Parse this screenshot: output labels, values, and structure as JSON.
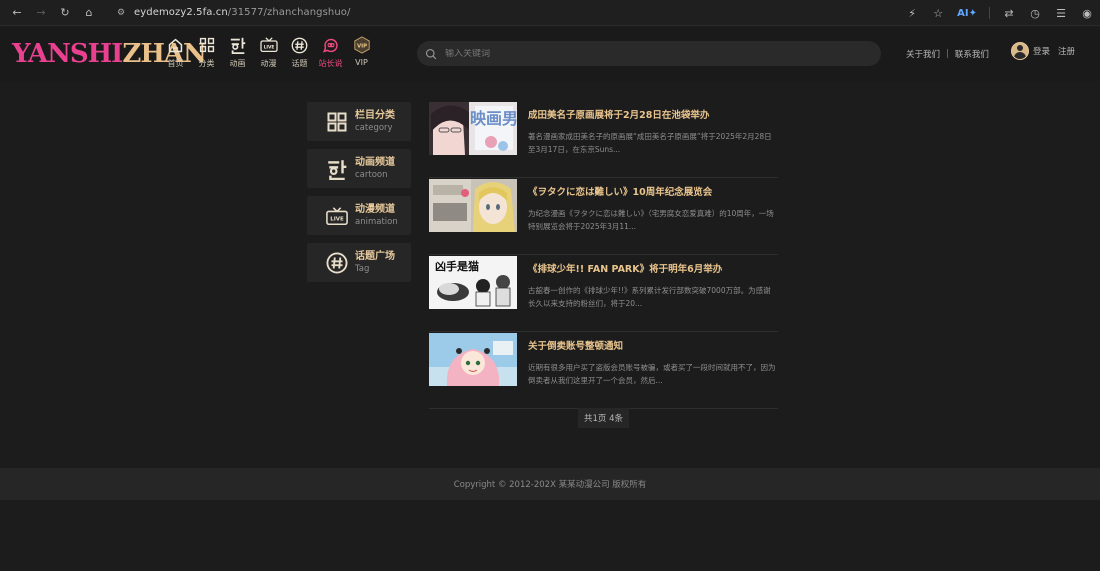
{
  "browser": {
    "url_host": "eydemozy2.5fa.cn",
    "url_path": "/31577/zhanchangshuo/",
    "ai_label": "AI"
  },
  "logo": {
    "part1": "YANSHI",
    "part2": "ZHAN"
  },
  "nav": {
    "items": [
      {
        "label": "首页",
        "icon": "home-icon"
      },
      {
        "label": "分类",
        "icon": "grid-icon"
      },
      {
        "label": "动画",
        "icon": "han-icon"
      },
      {
        "label": "动漫",
        "icon": "live-icon"
      },
      {
        "label": "话题",
        "icon": "hashtag-icon"
      },
      {
        "label": "站长说",
        "icon": "chat-icon",
        "active": true
      },
      {
        "label": "VIP",
        "icon": "vip-icon"
      }
    ]
  },
  "search": {
    "placeholder": "输入关键词"
  },
  "top_links": {
    "about": "关于我们",
    "divider": "|",
    "contact": "联系我们"
  },
  "user": {
    "login": "登录",
    "register": "注册"
  },
  "sidebar": {
    "items": [
      {
        "title": "栏目分类",
        "sub": "category",
        "icon": "grid-icon"
      },
      {
        "title": "动画频道",
        "sub": "cartoon",
        "icon": "han-icon"
      },
      {
        "title": "动漫频道",
        "sub": "animation",
        "icon": "live-icon"
      },
      {
        "title": "话题广场",
        "sub": "Tag",
        "icon": "hashtag-icon"
      }
    ]
  },
  "articles": [
    {
      "title": "成田美名子原画展将于2月28日在池袋举办",
      "desc": "著名漫画家成田美名子的原画展“成田美名子原画展”将于2025年2月28日至3月17日，在东京Suns..."
    },
    {
      "title": "《ヲタクに恋は難しい》10周年纪念展览会",
      "desc": "为纪念漫画《ヲタクに恋は難しい》（宅男腐女恋爱真难）的10周年，一场特别展览会将于2025年3月11..."
    },
    {
      "title": "《排球少年!! FAN PARK》将于明年6月举办",
      "desc": "古舘春一创作的《排球少年!!》系列累计发行部数突破7000万部。为感谢长久以来支持的粉丝们，将于20..."
    },
    {
      "title": "关于倒卖账号整顿通知",
      "desc": "近期有很多用户买了盗版会员账号被骗，或者买了一段时间就用不了，因为倒卖者从我们这里开了一个会员，然后..."
    }
  ],
  "thumb_text": {
    "t1": "映画男",
    "t3": "凶手是猫"
  },
  "pager": {
    "text": "共1页 4条"
  },
  "footer": {
    "copyright": "Copyright © 2012-202X 某某动漫公司 版权所有"
  }
}
